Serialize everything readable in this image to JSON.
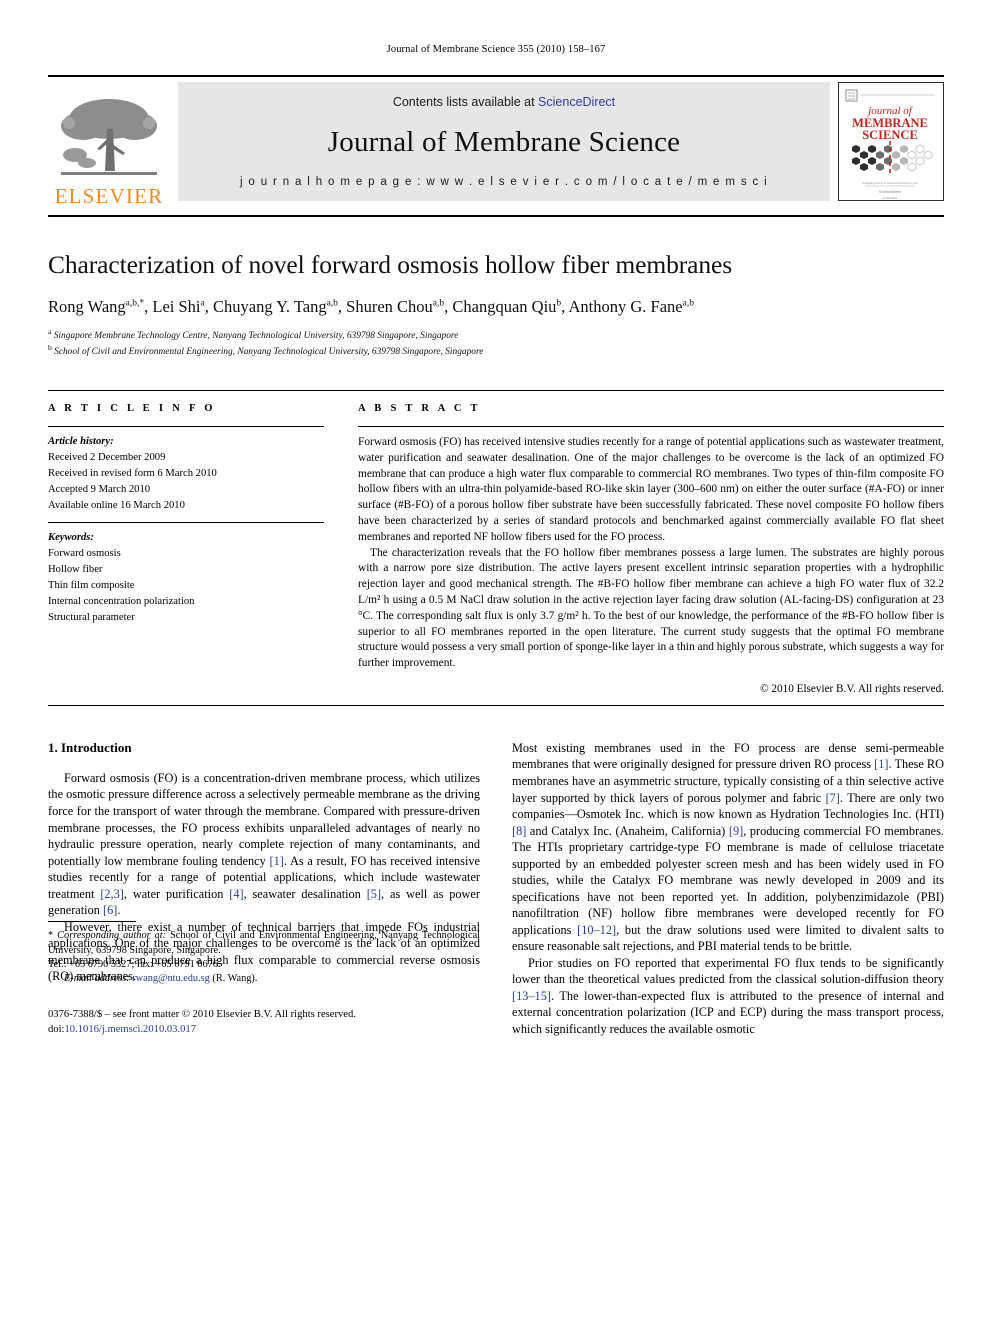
{
  "running_head": "Journal of Membrane Science 355 (2010) 158–167",
  "masthead": {
    "publisher_logo_name": "ELSEVIER",
    "contents_prefix": "Contents lists available at",
    "sciencedirect_link": "ScienceDirect",
    "journal_name": "Journal of Membrane Science",
    "homepage_label": "j o u r n a l   h o m e p a g e :   w w w . e l s e v i e r . c o m / l o c a t e / m e m s c i",
    "cover": {
      "line1": "journal of",
      "line2": "MEMBRANE",
      "line3": "SCIENCE",
      "accent_color": "#C0271C"
    }
  },
  "article": {
    "title": "Characterization of novel forward osmosis hollow fiber membranes",
    "authors_html": "Rong Wang<sup>a,b,</sup><sup>*</sup>, Lei Shi<sup>a</sup>, Chuyang Y. Tang<sup>a,b</sup>, Shuren Chou<sup>a,b</sup>, Changquan Qiu<sup>b</sup>, Anthony G. Fane<sup>a,b</sup>",
    "affiliation_a": "Singapore Membrane Technology Centre, Nanyang Technological University, 639798 Singapore, Singapore",
    "affiliation_b": "School of Civil and Environmental Engineering, Nanyang Technological University, 639798 Singapore, Singapore"
  },
  "article_info": {
    "heading": "A R T I C L E    I N F O",
    "history_label": "Article history:",
    "history": [
      "Received 2 December 2009",
      "Received in revised form 6 March 2010",
      "Accepted 9 March 2010",
      "Available online 16 March 2010"
    ],
    "keywords_label": "Keywords:",
    "keywords": [
      "Forward osmosis",
      "Hollow fiber",
      "Thin film composite",
      "Internal concentration polarization",
      "Structural parameter"
    ]
  },
  "abstract": {
    "heading": "A B S T R A C T",
    "paragraph1": "Forward osmosis (FO) has received intensive studies recently for a range of potential applications such as wastewater treatment, water purification and seawater desalination. One of the major challenges to be overcome is the lack of an optimized FO membrane that can produce a high water flux comparable to commercial RO membranes. Two types of thin-film composite FO hollow fibers with an ultra-thin polyamide-based RO-like skin layer (300–600 nm) on either the outer surface (#A-FO) or inner surface (#B-FO) of a porous hollow fiber substrate have been successfully fabricated. These novel composite FO hollow fibers have been characterized by a series of standard protocols and benchmarked against commercially available FO flat sheet membranes and reported NF hollow fibers used for the FO process.",
    "paragraph2": "The characterization reveals that the FO hollow fiber membranes possess a large lumen. The substrates are highly porous with a narrow pore size distribution. The active layers present excellent intrinsic separation properties with a hydrophilic rejection layer and good mechanical strength. The #B-FO hollow fiber membrane can achieve a high FO water flux of 32.2 L/m² h using a 0.5 M NaCl draw solution in the active rejection layer facing draw solution (AL-facing-DS) configuration at 23 °C. The corresponding salt flux is only 3.7 g/m² h. To the best of our knowledge, the performance of the #B-FO hollow fiber is superior to all FO membranes reported in the open literature. The current study suggests that the optimal FO membrane structure would possess a very small portion of sponge-like layer in a thin and highly porous substrate, which suggests a way for further improvement.",
    "copyright": "© 2010 Elsevier B.V. All rights reserved."
  },
  "body": {
    "section1_title": "1.  Introduction",
    "left_p1_html": "Forward osmosis (FO) is a concentration-driven membrane process, which utilizes the osmotic pressure difference across a selectively permeable membrane as the driving force for the transport of water through the membrane. Compared with pressure-driven membrane processes, the FO process exhibits unparalleled advantages of nearly no hydraulic pressure operation, nearly complete rejection of many contaminants, and potentially low membrane fouling tendency <span class=\"ref\">[1]</span>. As a result, FO has received intensive studies recently for a range of potential applications, which include wastewater treatment <span class=\"ref\">[2,3]</span>, water purification <span class=\"ref\">[4]</span>, seawater desalination <span class=\"ref\">[5]</span>, as well as power generation <span class=\"ref\">[6]</span>.",
    "left_p2_html": "However, there exist a number of technical barriers that impede FOs industrial applications. One of the major challenges to be overcome is the lack of an optimized membrane that can produce a high flux comparable to commercial reverse osmosis (RO) membranes.",
    "right_p1_html": "Most existing membranes used in the FO process are dense semi-permeable membranes that were originally designed for pressure driven RO process <span class=\"ref\">[1]</span>. These RO membranes have an asymmetric structure, typically consisting of a thin selective active layer supported by thick layers of porous polymer and fabric <span class=\"ref\">[7]</span>. There are only two companies—Osmotek Inc. which is now known as Hydration Technologies Inc. (HTI) <span class=\"ref\">[8]</span> and Catalyx Inc. (Anaheim, California) <span class=\"ref\">[9]</span>, producing commercial FO membranes. The HTIs proprietary cartridge-type FO membrane is made of cellulose triacetate supported by an embedded polyester screen mesh and has been widely used in FO studies, while the Catalyx FO membrane was newly developed in 2009 and its specifications have not been reported yet. In addition, polybenzimidazole (PBI) nanofiltration (NF) hollow fibre membranes were developed recently for FO applications <span class=\"ref\">[10–12]</span>, but the draw solutions used were limited to divalent salts to ensure reasonable salt rejections, and PBI material tends to be brittle.",
    "right_p2_html": "Prior studies on FO reported that experimental FO flux tends to be significantly lower than the theoretical values predicted from the classical solution-diffusion theory <span class=\"ref\">[13–15]</span>. The lower-than-expected flux is attributed to the presence of internal and external concentration polarization (ICP and ECP) during the mass transport process, which significantly reduces the available osmotic"
  },
  "footnote": {
    "corresponding_html": "<span class=\"star\">*</span> <i>Corresponding author at:</i> School of Civil and Environmental Engineering, Nanyang Technological University, 639798 Singapore, Singapore.",
    "tel_line": "Tel.: +65 6790 5327; fax: +65 6791 0676.",
    "email_label": "E-mail address:",
    "email": "rwang@ntu.edu.sg",
    "email_owner": "(R. Wang).",
    "imprint_line": "0376-7388/$ – see front matter © 2010 Elsevier B.V. All rights reserved.",
    "doi_label": "doi:",
    "doi_value": "10.1016/j.memsci.2010.03.017"
  }
}
